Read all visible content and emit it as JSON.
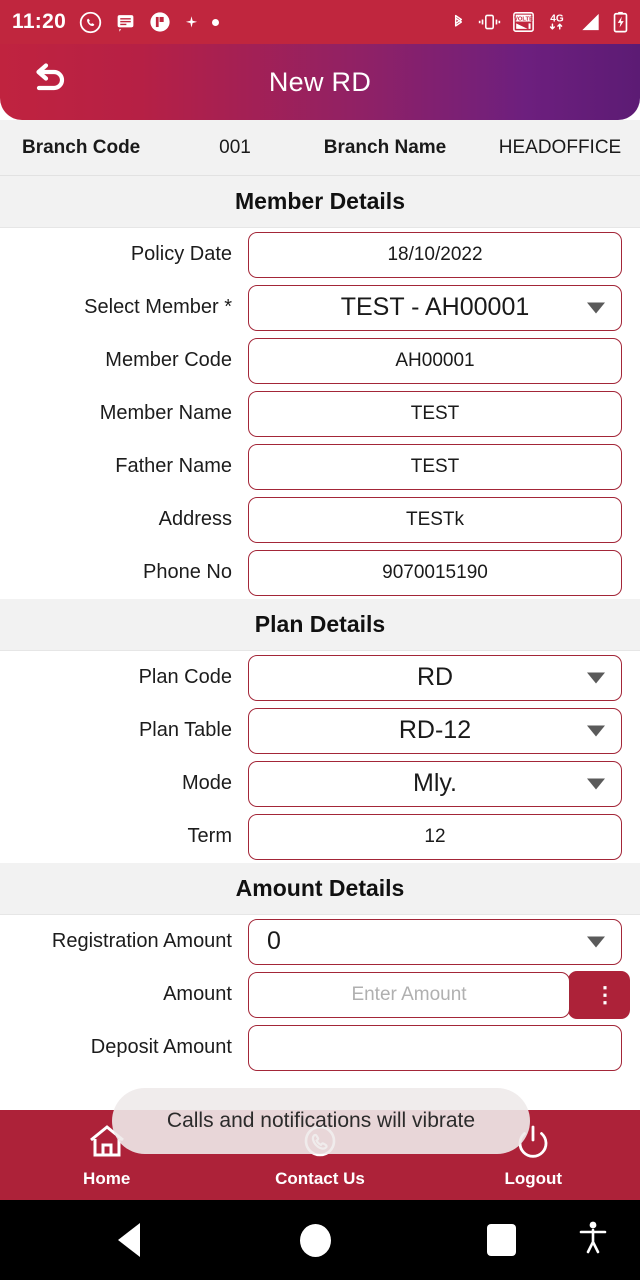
{
  "status_bar": {
    "time": "11:20",
    "left_icons": [
      "whatsapp-icon",
      "message-icon",
      "app-icon",
      "sparkle-icon",
      "dot-icon"
    ],
    "right_icons": [
      "bluetooth-icon",
      "vibrate-icon",
      "volte-icon",
      "4g-icon",
      "signal-icon",
      "battery-charging-icon"
    ],
    "network_label": "4G",
    "volte_label": "VOLTE"
  },
  "header": {
    "title": "New RD",
    "back_icon": "back-arrow-icon",
    "gradient_from": "#c0233f",
    "gradient_to": "#5c1b74"
  },
  "branch": {
    "code_label": "Branch Code",
    "code_value": "001",
    "name_label": "Branch Name",
    "name_value": "HEADOFFICE"
  },
  "sections": [
    {
      "title": "Member Details",
      "rows": [
        {
          "label": "Policy Date",
          "value": "18/10/2022",
          "type": "text",
          "big": false
        },
        {
          "label": "Select Member *",
          "value": "TEST - AH00001",
          "type": "select",
          "big": true
        },
        {
          "label": "Member Code",
          "value": "AH00001",
          "type": "text",
          "big": false
        },
        {
          "label": "Member Name",
          "value": "TEST",
          "type": "text",
          "big": false
        },
        {
          "label": "Father Name",
          "value": "TEST",
          "type": "text",
          "big": false
        },
        {
          "label": "Address",
          "value": "TESTk",
          "type": "text",
          "big": false
        },
        {
          "label": "Phone No",
          "value": "9070015190",
          "type": "text",
          "big": false
        }
      ]
    },
    {
      "title": "Plan Details",
      "rows": [
        {
          "label": "Plan Code",
          "value": "RD",
          "type": "select",
          "big": true
        },
        {
          "label": "Plan Table",
          "value": "RD-12",
          "type": "select",
          "big": true
        },
        {
          "label": "Mode",
          "value": "Mly.",
          "type": "select",
          "big": true
        },
        {
          "label": "Term",
          "value": "12",
          "type": "text",
          "big": false
        }
      ]
    },
    {
      "title": "Amount Details",
      "rows": [
        {
          "label": "Registration Amount",
          "value": "0",
          "type": "select",
          "big": true,
          "align": "left"
        },
        {
          "label": "Amount",
          "value": "",
          "placeholder": "Enter Amount",
          "type": "input-with-button",
          "big": false,
          "button_glyph": "⋮",
          "button_name": "amount-options-button"
        },
        {
          "label": "Deposit Amount",
          "value": "",
          "type": "text",
          "big": false
        }
      ]
    }
  ],
  "toast": {
    "message": "Calls and notifications will vibrate"
  },
  "bottom_nav": [
    {
      "label": "Home",
      "icon": "home-icon"
    },
    {
      "label": "Contact Us",
      "icon": "phone-icon"
    },
    {
      "label": "Logout",
      "icon": "power-icon"
    }
  ],
  "android_nav": {
    "back": "back-triangle-icon",
    "home": "home-circle-icon",
    "recents": "recents-square-icon",
    "accessibility": "accessibility-icon"
  },
  "colors": {
    "brand_red": "#ad2239",
    "border_red": "#a32638",
    "header_purple": "#5c1b74",
    "section_bg": "#f2f2f2"
  }
}
